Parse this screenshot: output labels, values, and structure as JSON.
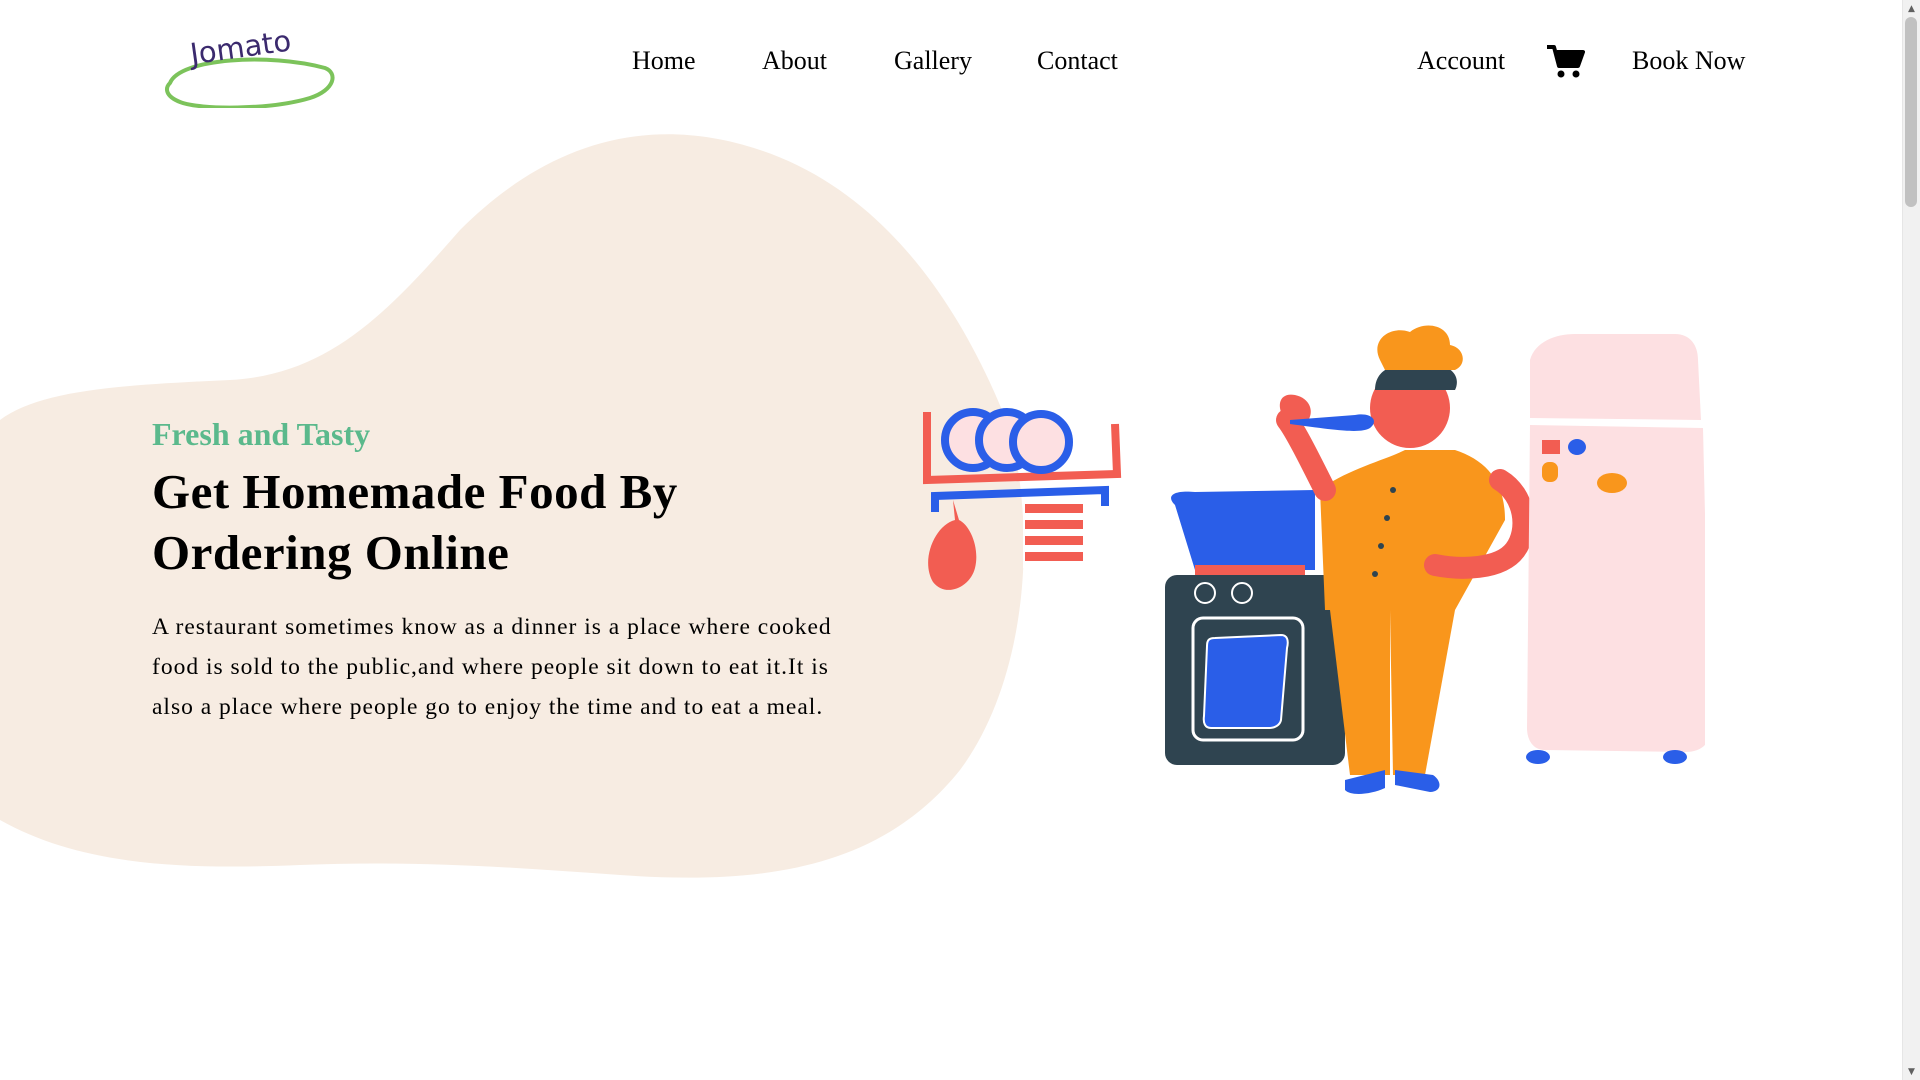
{
  "brand": {
    "logo_text": "Jomato"
  },
  "nav": {
    "home": "Home",
    "about": "About",
    "gallery": "Gallery",
    "contact": "Contact",
    "account": "Account",
    "cart_icon": "shopping-cart-icon",
    "book_now": "Book Now"
  },
  "hero": {
    "eyebrow": "Fresh and Tasty",
    "headline_line1": "Get Homemade Food By",
    "headline_line2": "Ordering Online",
    "description": "A restaurant sometimes know as a dinner is a place where cooked food is sold to the public,and where people sit down to eat it.It is also a place where people go to enjoy the time and to eat a meal."
  },
  "colors": {
    "accent_green": "#5bb98c",
    "blob_beige": "#f7ece2",
    "chef_orange": "#f9961c",
    "chef_skin": "#f25d52",
    "stove_dark": "#2f4450",
    "utensil_blue": "#2a5ee8",
    "fridge_pink": "#fde0e2",
    "logo_purple": "#3b2a6e",
    "logo_green": "#7cc35b"
  }
}
